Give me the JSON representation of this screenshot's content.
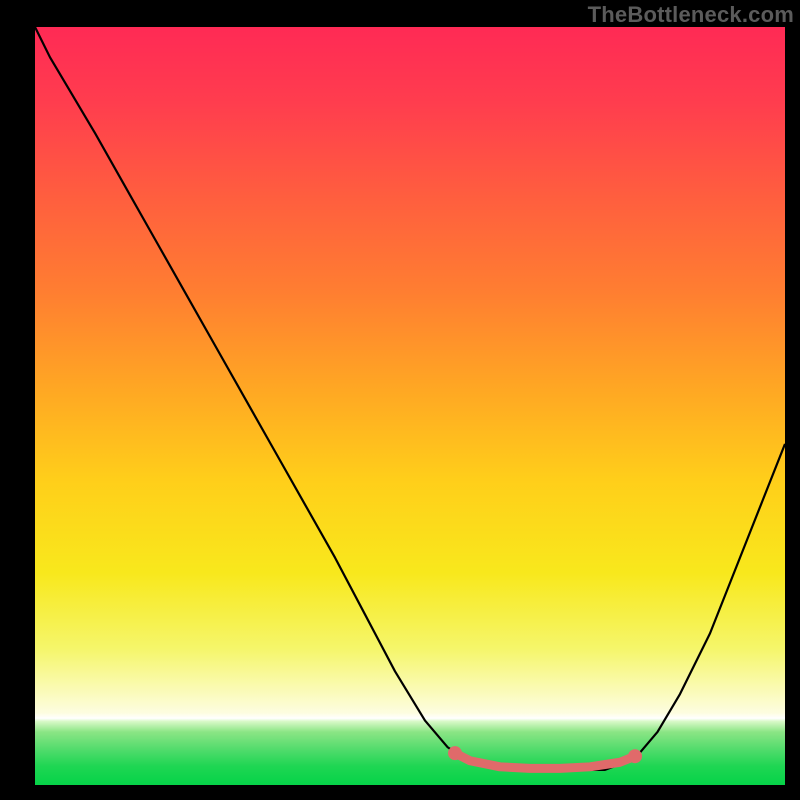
{
  "watermark": "TheBottleneck.com",
  "chart_data": {
    "type": "line",
    "title": "",
    "xlabel": "",
    "ylabel": "",
    "xlim": [
      0,
      100
    ],
    "ylim": [
      0,
      100
    ],
    "grid": false,
    "legend": false,
    "gradient": {
      "stops": [
        {
          "offset": 0.0,
          "color": "#ff2a55"
        },
        {
          "offset": 0.1,
          "color": "#ff3d4e"
        },
        {
          "offset": 0.22,
          "color": "#ff5d3f"
        },
        {
          "offset": 0.35,
          "color": "#ff7e31"
        },
        {
          "offset": 0.48,
          "color": "#ffa823"
        },
        {
          "offset": 0.6,
          "color": "#ffcf1a"
        },
        {
          "offset": 0.72,
          "color": "#f8e81c"
        },
        {
          "offset": 0.82,
          "color": "#f5f66a"
        },
        {
          "offset": 0.905,
          "color": "#fdfde0"
        },
        {
          "offset": 0.912,
          "color": "#ffffff"
        },
        {
          "offset": 0.916,
          "color": "#d9f9c8"
        },
        {
          "offset": 0.93,
          "color": "#8be585"
        },
        {
          "offset": 0.955,
          "color": "#4ddb6a"
        },
        {
          "offset": 0.975,
          "color": "#1fd653"
        },
        {
          "offset": 1.0,
          "color": "#06d348"
        }
      ]
    },
    "series": [
      {
        "name": "bottleneck-curve",
        "color": "#000000",
        "x": [
          0,
          2,
          5,
          8,
          12,
          16,
          20,
          24,
          28,
          32,
          36,
          40,
          44,
          48,
          52,
          55,
          58,
          62,
          66,
          70,
          76,
          80,
          83,
          86,
          90,
          94,
          97,
          100
        ],
        "y": [
          100,
          96,
          91,
          86,
          79,
          72,
          65,
          58,
          51,
          44,
          37,
          30,
          22.5,
          15,
          8.5,
          5,
          3,
          2,
          2,
          2,
          2,
          3.5,
          7,
          12,
          20,
          30,
          37.5,
          45
        ]
      },
      {
        "name": "highlight-band",
        "color": "#e06a6a",
        "x": [
          56,
          58,
          62,
          66,
          70,
          74,
          78,
          80
        ],
        "y": [
          4.2,
          3.2,
          2.4,
          2.2,
          2.2,
          2.4,
          3.0,
          3.8
        ]
      }
    ],
    "highlight_caps": [
      {
        "x": 56,
        "y": 4.2
      },
      {
        "x": 80,
        "y": 3.8
      }
    ]
  }
}
